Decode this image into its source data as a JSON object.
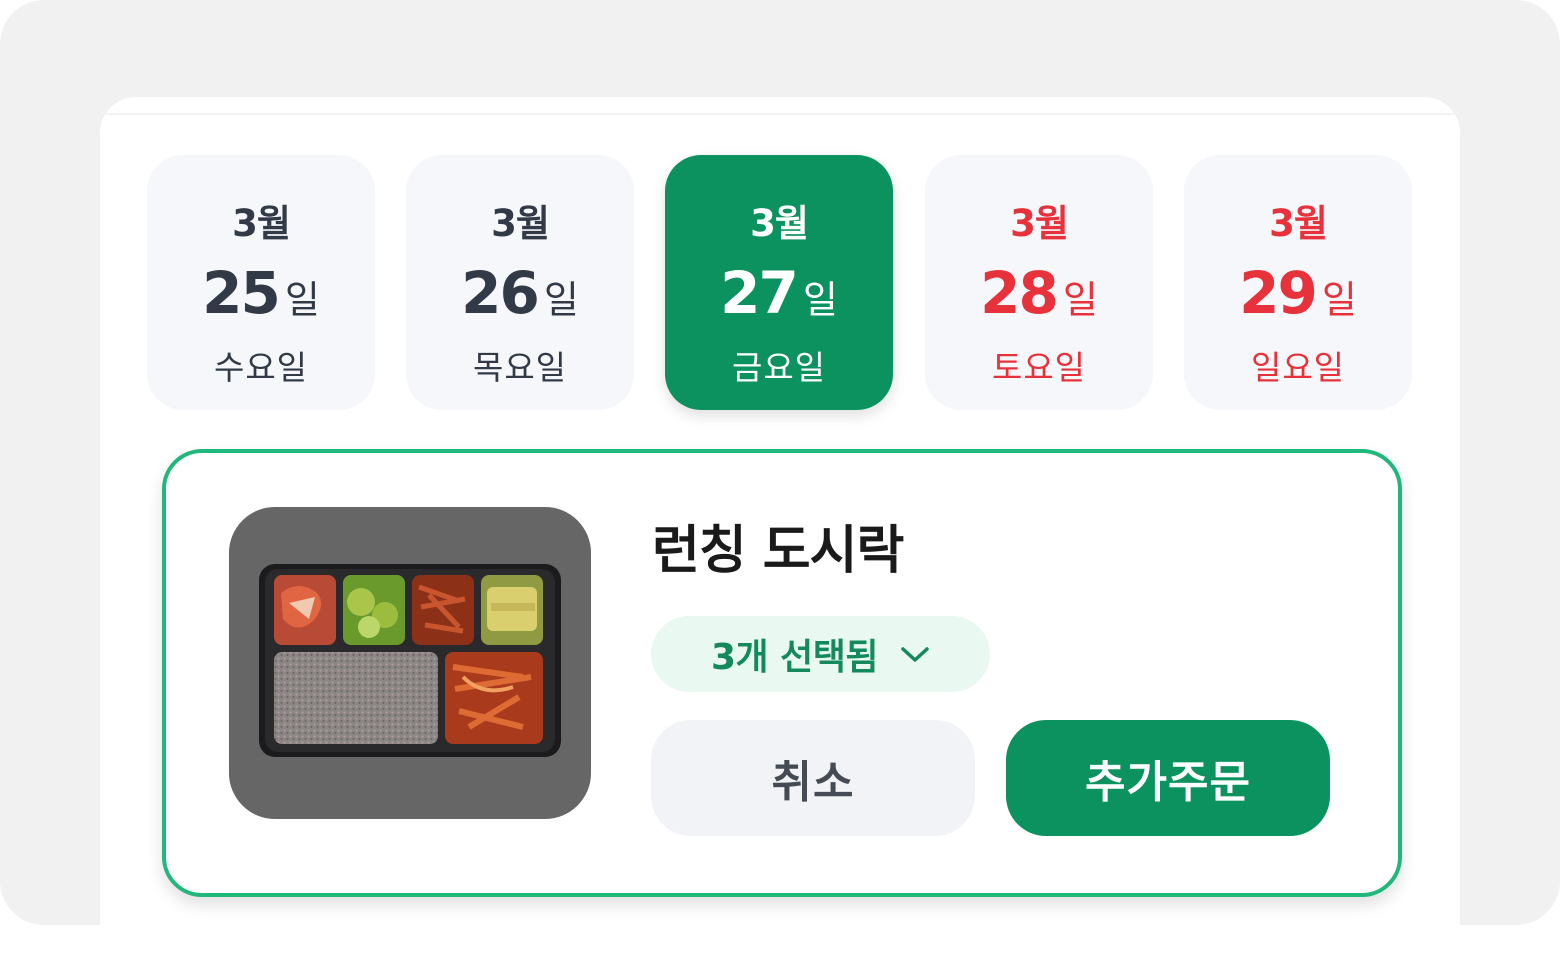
{
  "dates": [
    {
      "month": "3월",
      "day": "25",
      "suffix": "일",
      "weekday": "수요일"
    },
    {
      "month": "3월",
      "day": "26",
      "suffix": "일",
      "weekday": "목요일"
    },
    {
      "month": "3월",
      "day": "27",
      "suffix": "일",
      "weekday": "금요일"
    },
    {
      "month": "3월",
      "day": "28",
      "suffix": "일",
      "weekday": "토요일"
    },
    {
      "month": "3월",
      "day": "29",
      "suffix": "일",
      "weekday": "일요일"
    }
  ],
  "selected_date_index": 2,
  "order": {
    "product_title": "런칭 도시락",
    "selection_label": "3개 선택됨",
    "cancel_label": "취소",
    "add_order_label": "추가주문"
  },
  "icons": {
    "dropdown": "chevron-down-icon"
  },
  "colors": {
    "accent_green": "#0b925f",
    "card_border": "#1fb77a",
    "weekend_red": "#e8323b",
    "text_dark": "#333a47"
  }
}
